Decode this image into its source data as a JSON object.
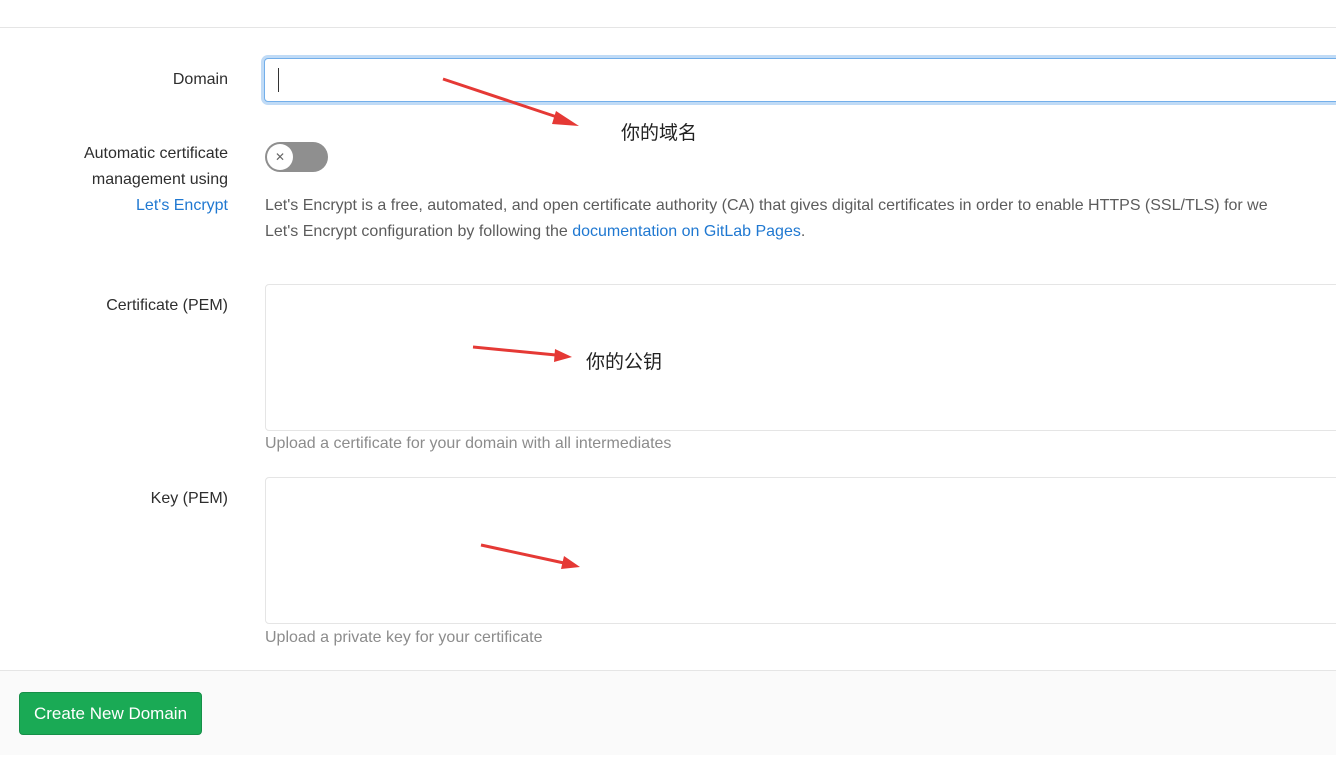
{
  "form": {
    "domain": {
      "label": "Domain",
      "value": "",
      "annotation": "你的域名"
    },
    "auto_cert": {
      "label_line1": "Automatic certificate",
      "label_line2": "management using",
      "label_link": "Let's Encrypt",
      "enabled": false,
      "help_line1": "Let's Encrypt is a free, automated, and open certificate authority (CA) that gives digital certificates in order to enable HTTPS (SSL/TLS) for we",
      "help_line2_prefix": "Let's Encrypt configuration by following the ",
      "help_link": "documentation on GitLab Pages",
      "help_line2_suffix": "."
    },
    "certificate": {
      "label": "Certificate (PEM)",
      "value": "",
      "hint": "Upload a certificate for your domain with all intermediates",
      "annotation": "你的公钥"
    },
    "key": {
      "label": "Key (PEM)",
      "value": "",
      "hint": "Upload a private key for your certificate"
    }
  },
  "footer": {
    "submit_label": "Create New Domain"
  },
  "colors": {
    "primary_button": "#1aaa55",
    "link": "#1f78d1",
    "annotation_arrow": "#e53935"
  }
}
